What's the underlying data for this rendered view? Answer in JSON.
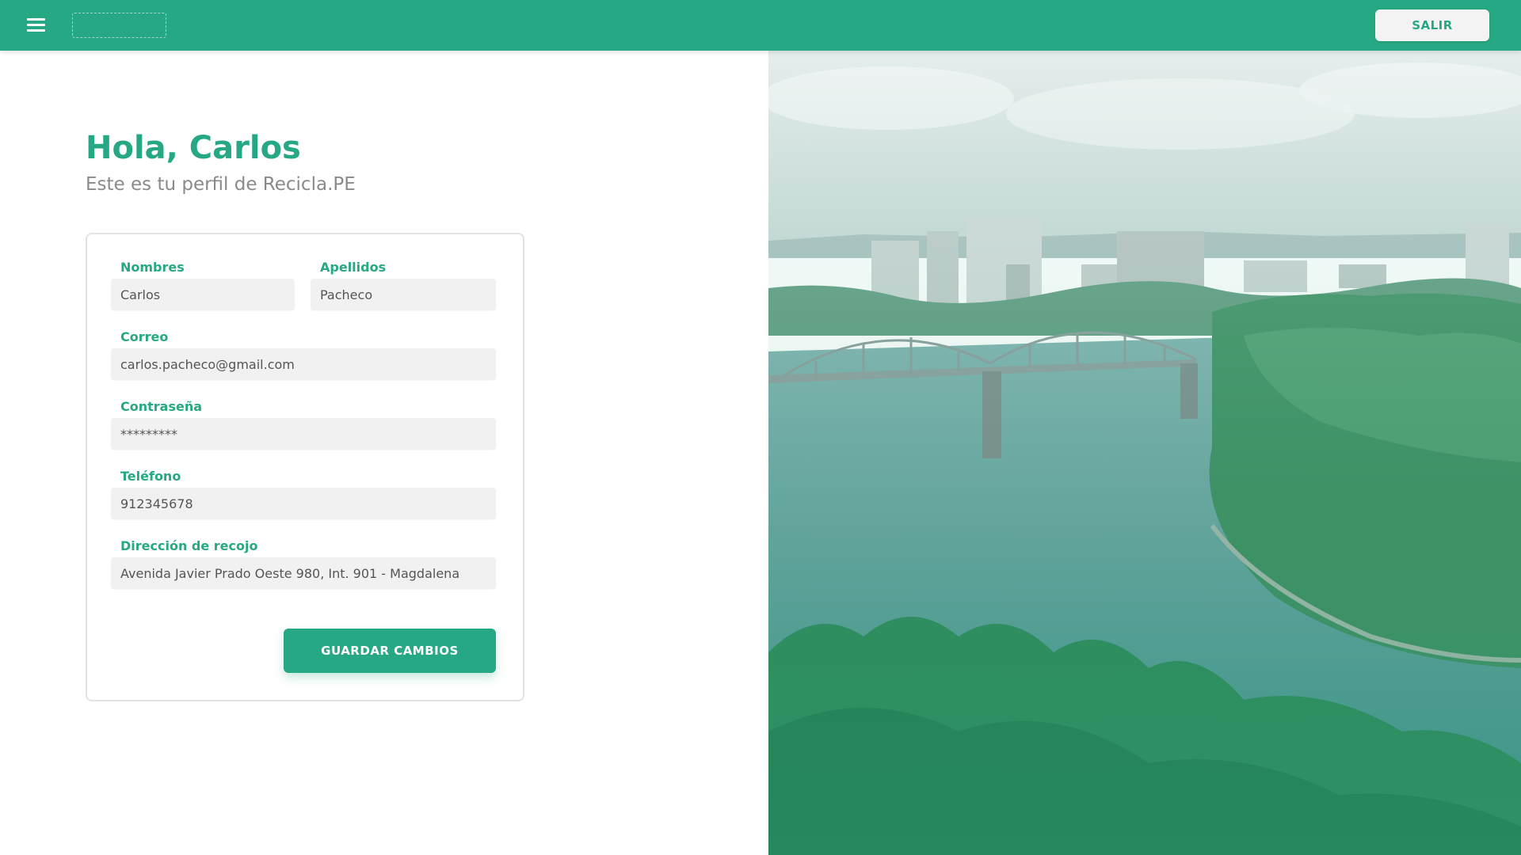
{
  "topbar": {
    "logout_label": "SALIR",
    "menu_icon": "hamburger-menu-icon"
  },
  "profile": {
    "greeting": "Hola, Carlos",
    "subtitle": "Este es tu perfil de Recicla.PE"
  },
  "form": {
    "first_name_label": "Nombres",
    "first_name_value": "Carlos",
    "last_name_label": "Apellidos",
    "last_name_value": "Pacheco",
    "email_label": "Correo",
    "email_value": "carlos.pacheco@gmail.com",
    "password_label": "Contraseña",
    "password_value": "*********",
    "phone_label": "Teléfono",
    "phone_value": "912345678",
    "address_label": "Dirección de recojo",
    "address_value": "Avenida Javier Prado Oeste 980, Int. 901 - Magdalena",
    "save_label": "GUARDAR CAMBIOS"
  },
  "colors": {
    "brand": "#27a884",
    "topbar_bg": "#27a884",
    "input_bg": "#f1f1f1",
    "subtitle_text": "#8a8a8a"
  }
}
